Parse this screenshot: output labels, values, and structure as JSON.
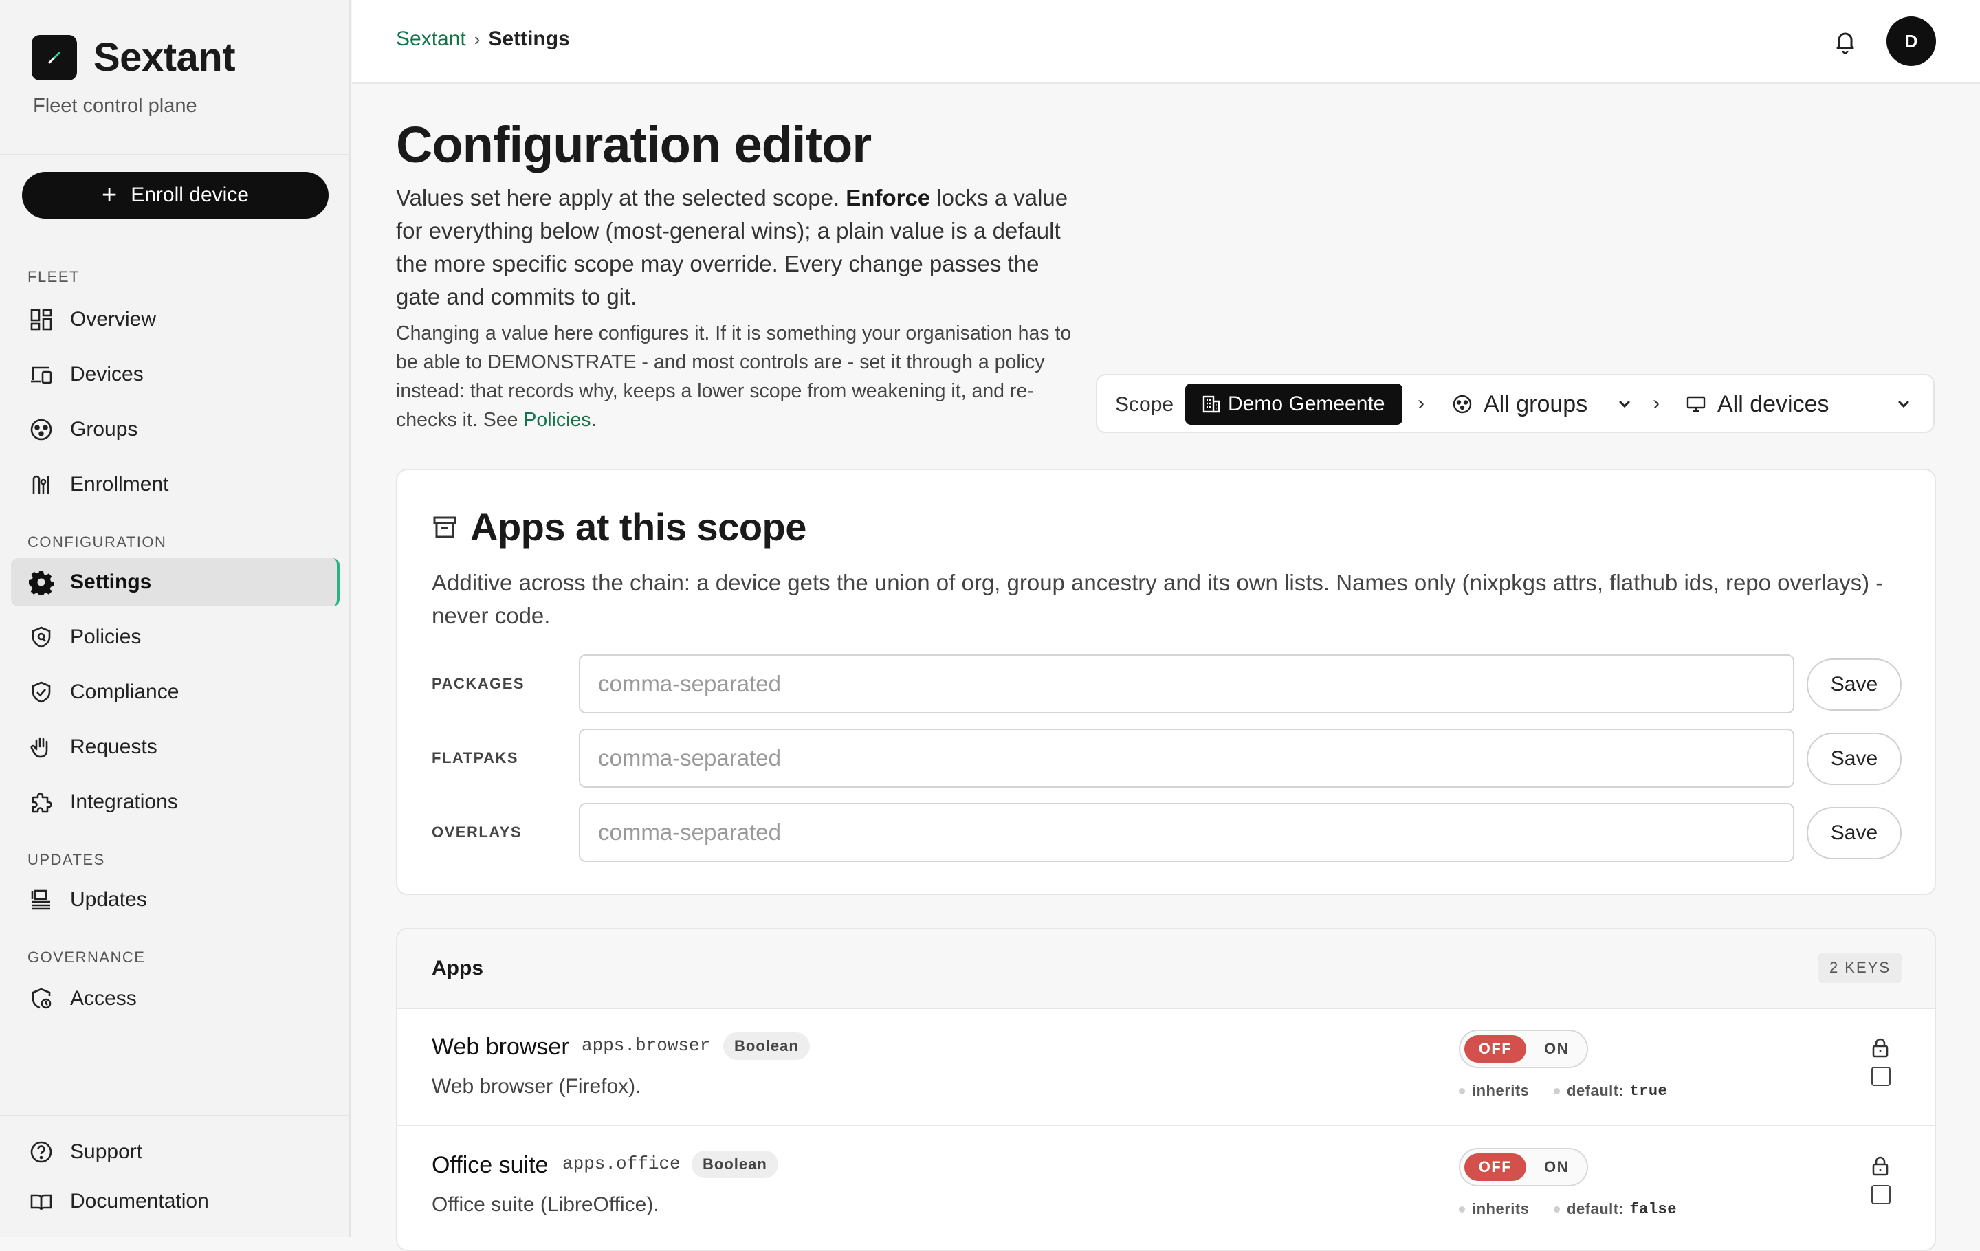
{
  "brand": {
    "name": "Sextant",
    "subtitle": "Fleet control plane"
  },
  "sidebar": {
    "enroll_label": "Enroll device",
    "sections": {
      "fleet": "FLEET",
      "configuration": "CONFIGURATION",
      "updates": "UPDATES",
      "governance": "GOVERNANCE"
    },
    "items": {
      "overview": "Overview",
      "devices": "Devices",
      "groups": "Groups",
      "enrollment": "Enrollment",
      "settings": "Settings",
      "policies": "Policies",
      "compliance": "Compliance",
      "requests": "Requests",
      "integrations": "Integrations",
      "updates": "Updates",
      "access": "Access",
      "support": "Support",
      "documentation": "Documentation"
    },
    "active_item": "settings",
    "active_color": "#27b383"
  },
  "topbar": {
    "breadcrumb": [
      "Sextant",
      "Settings"
    ],
    "avatar_initial": "D"
  },
  "page": {
    "title": "Configuration editor",
    "intro_part1": "Values set here apply at the selected scope. ",
    "intro_bold": "Enforce",
    "intro_part2": " locks a value for everything below (most-general wins); a plain value is a default the more specific scope may override. Every change passes the gate and commits to git.",
    "note_text": "Changing a value here configures it. If it is something your organisation has to be able to DEMONSTRATE - and most controls are - set it through a policy instead: that records why, keeps a lower scope from weakening it, and re-checks it. See ",
    "note_link": "Policies",
    "note_end": "."
  },
  "scope": {
    "label": "Scope",
    "org": "Demo Gemeente",
    "group": "All groups",
    "device": "All devices"
  },
  "apps_card": {
    "title": "Apps at this scope",
    "description": "Additive across the chain: a device gets the union of org, group ancestry and its own lists. Names only (nixpkgs attrs, flathub ids, repo overlays) - never code.",
    "fields": [
      {
        "label": "PACKAGES",
        "value": "",
        "placeholder": "comma-separated",
        "button": "Save"
      },
      {
        "label": "FLATPAKS",
        "value": "",
        "placeholder": "comma-separated",
        "button": "Save"
      },
      {
        "label": "OVERLAYS",
        "value": "",
        "placeholder": "comma-separated",
        "button": "Save"
      }
    ]
  },
  "settings_group": {
    "title": "Apps",
    "badge": "2 KEYS",
    "items": [
      {
        "name": "Web browser",
        "key": "apps.browser",
        "type": "Boolean",
        "description": "Web browser (Firefox).",
        "toggle_off": "OFF",
        "toggle_on": "ON",
        "value": "off",
        "inherits_label": "inherits",
        "default_label": "default:",
        "default_value": "true"
      },
      {
        "name": "Office suite",
        "key": "apps.office",
        "type": "Boolean",
        "description": "Office suite (LibreOffice).",
        "toggle_off": "OFF",
        "toggle_on": "ON",
        "value": "off",
        "inherits_label": "inherits",
        "default_label": "default:",
        "default_value": "false"
      }
    ]
  },
  "colors": {
    "accent_link": "#16744b",
    "toggle_off": "#d4504c",
    "primary_button": "#0f0f0f"
  }
}
